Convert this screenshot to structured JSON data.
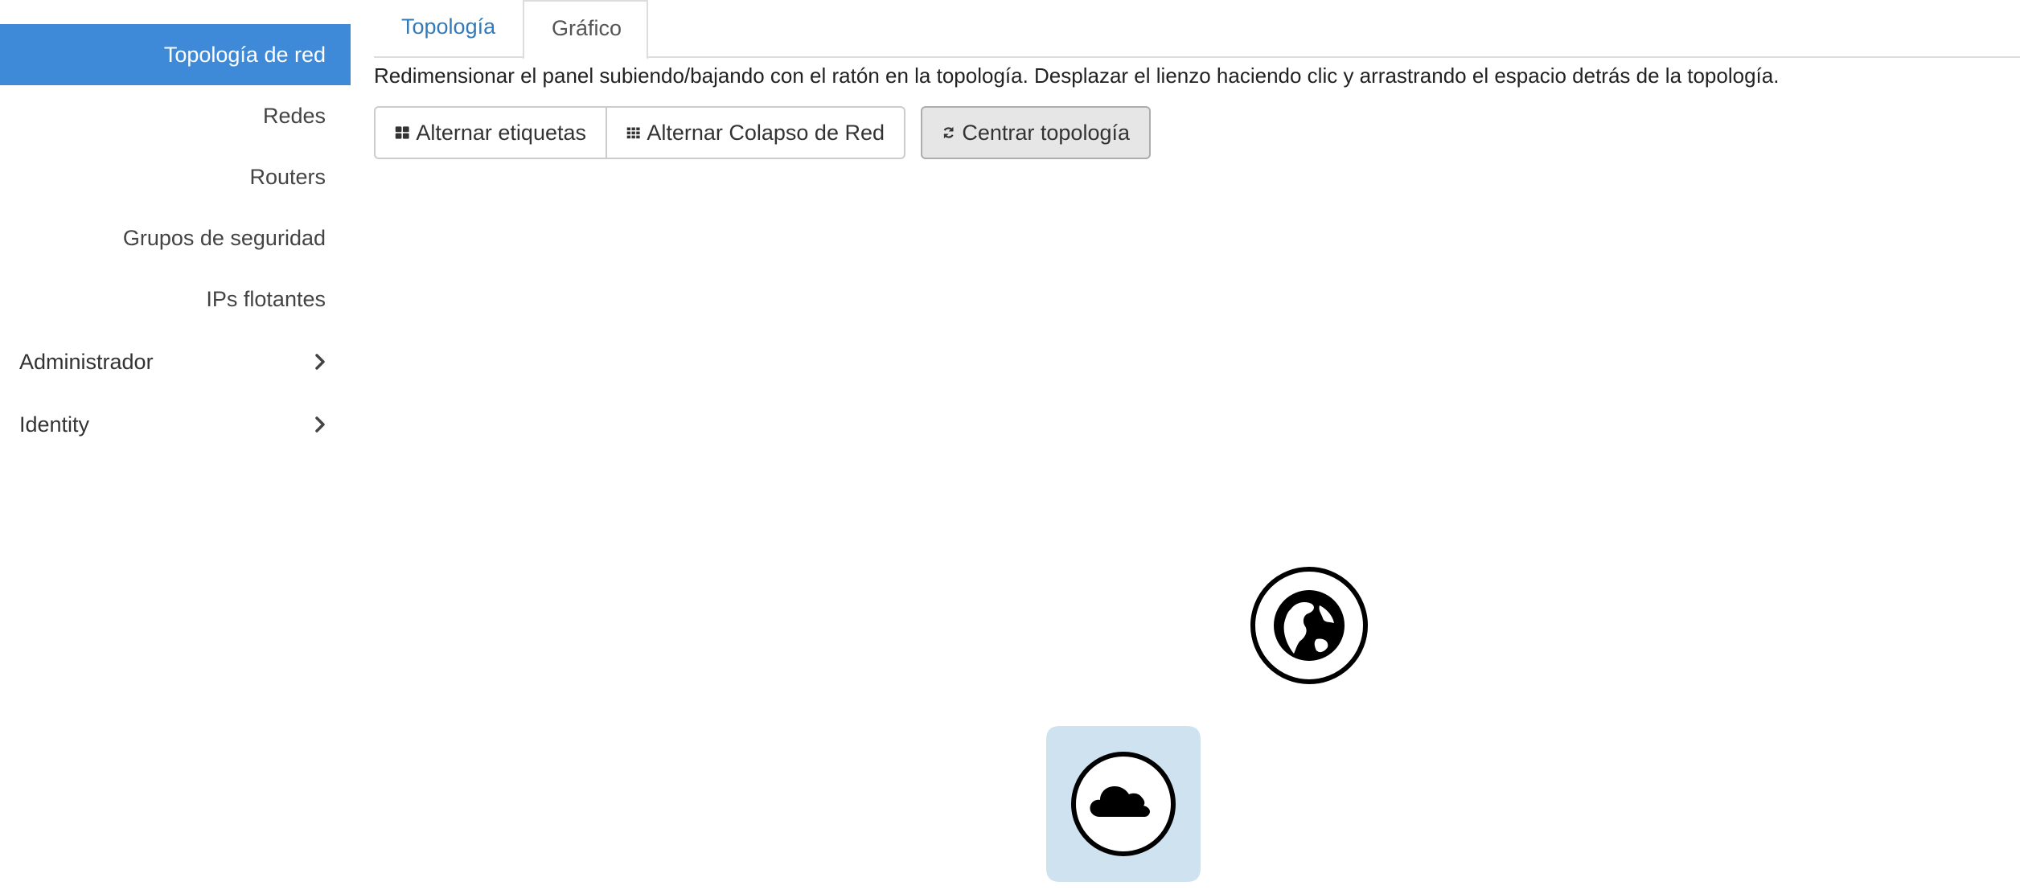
{
  "sidebar": {
    "items": [
      {
        "label": "Topología de red",
        "active": true
      },
      {
        "label": "Redes"
      },
      {
        "label": "Routers"
      },
      {
        "label": "Grupos de seguridad"
      },
      {
        "label": "IPs flotantes"
      }
    ],
    "sections": [
      {
        "label": "Administrador",
        "icon": "chevron-right-icon"
      },
      {
        "label": "Identity",
        "icon": "chevron-right-icon"
      }
    ]
  },
  "tabs": [
    {
      "label": "Topología",
      "active": true
    },
    {
      "label": "Gráfico"
    }
  ],
  "help_text": "Redimensionar el panel subiendo/bajando con el ratón en la topología. Desplazar el lienzo haciendo clic y arrastrando el espacio detrás de la topología.",
  "toolbar": {
    "toggle_labels": "Alternar etiquetas",
    "toggle_collapse": "Alternar Colapso de Red",
    "center_topology": "Centrar topología"
  },
  "colors": {
    "accent": "#3e8ad8",
    "network_node_bg": "#cfe2f0",
    "link": "#337ab7"
  },
  "topology": {
    "nodes": [
      {
        "type": "external-network",
        "icon": "globe-icon"
      },
      {
        "type": "network",
        "icon": "cloud-icon"
      }
    ]
  }
}
